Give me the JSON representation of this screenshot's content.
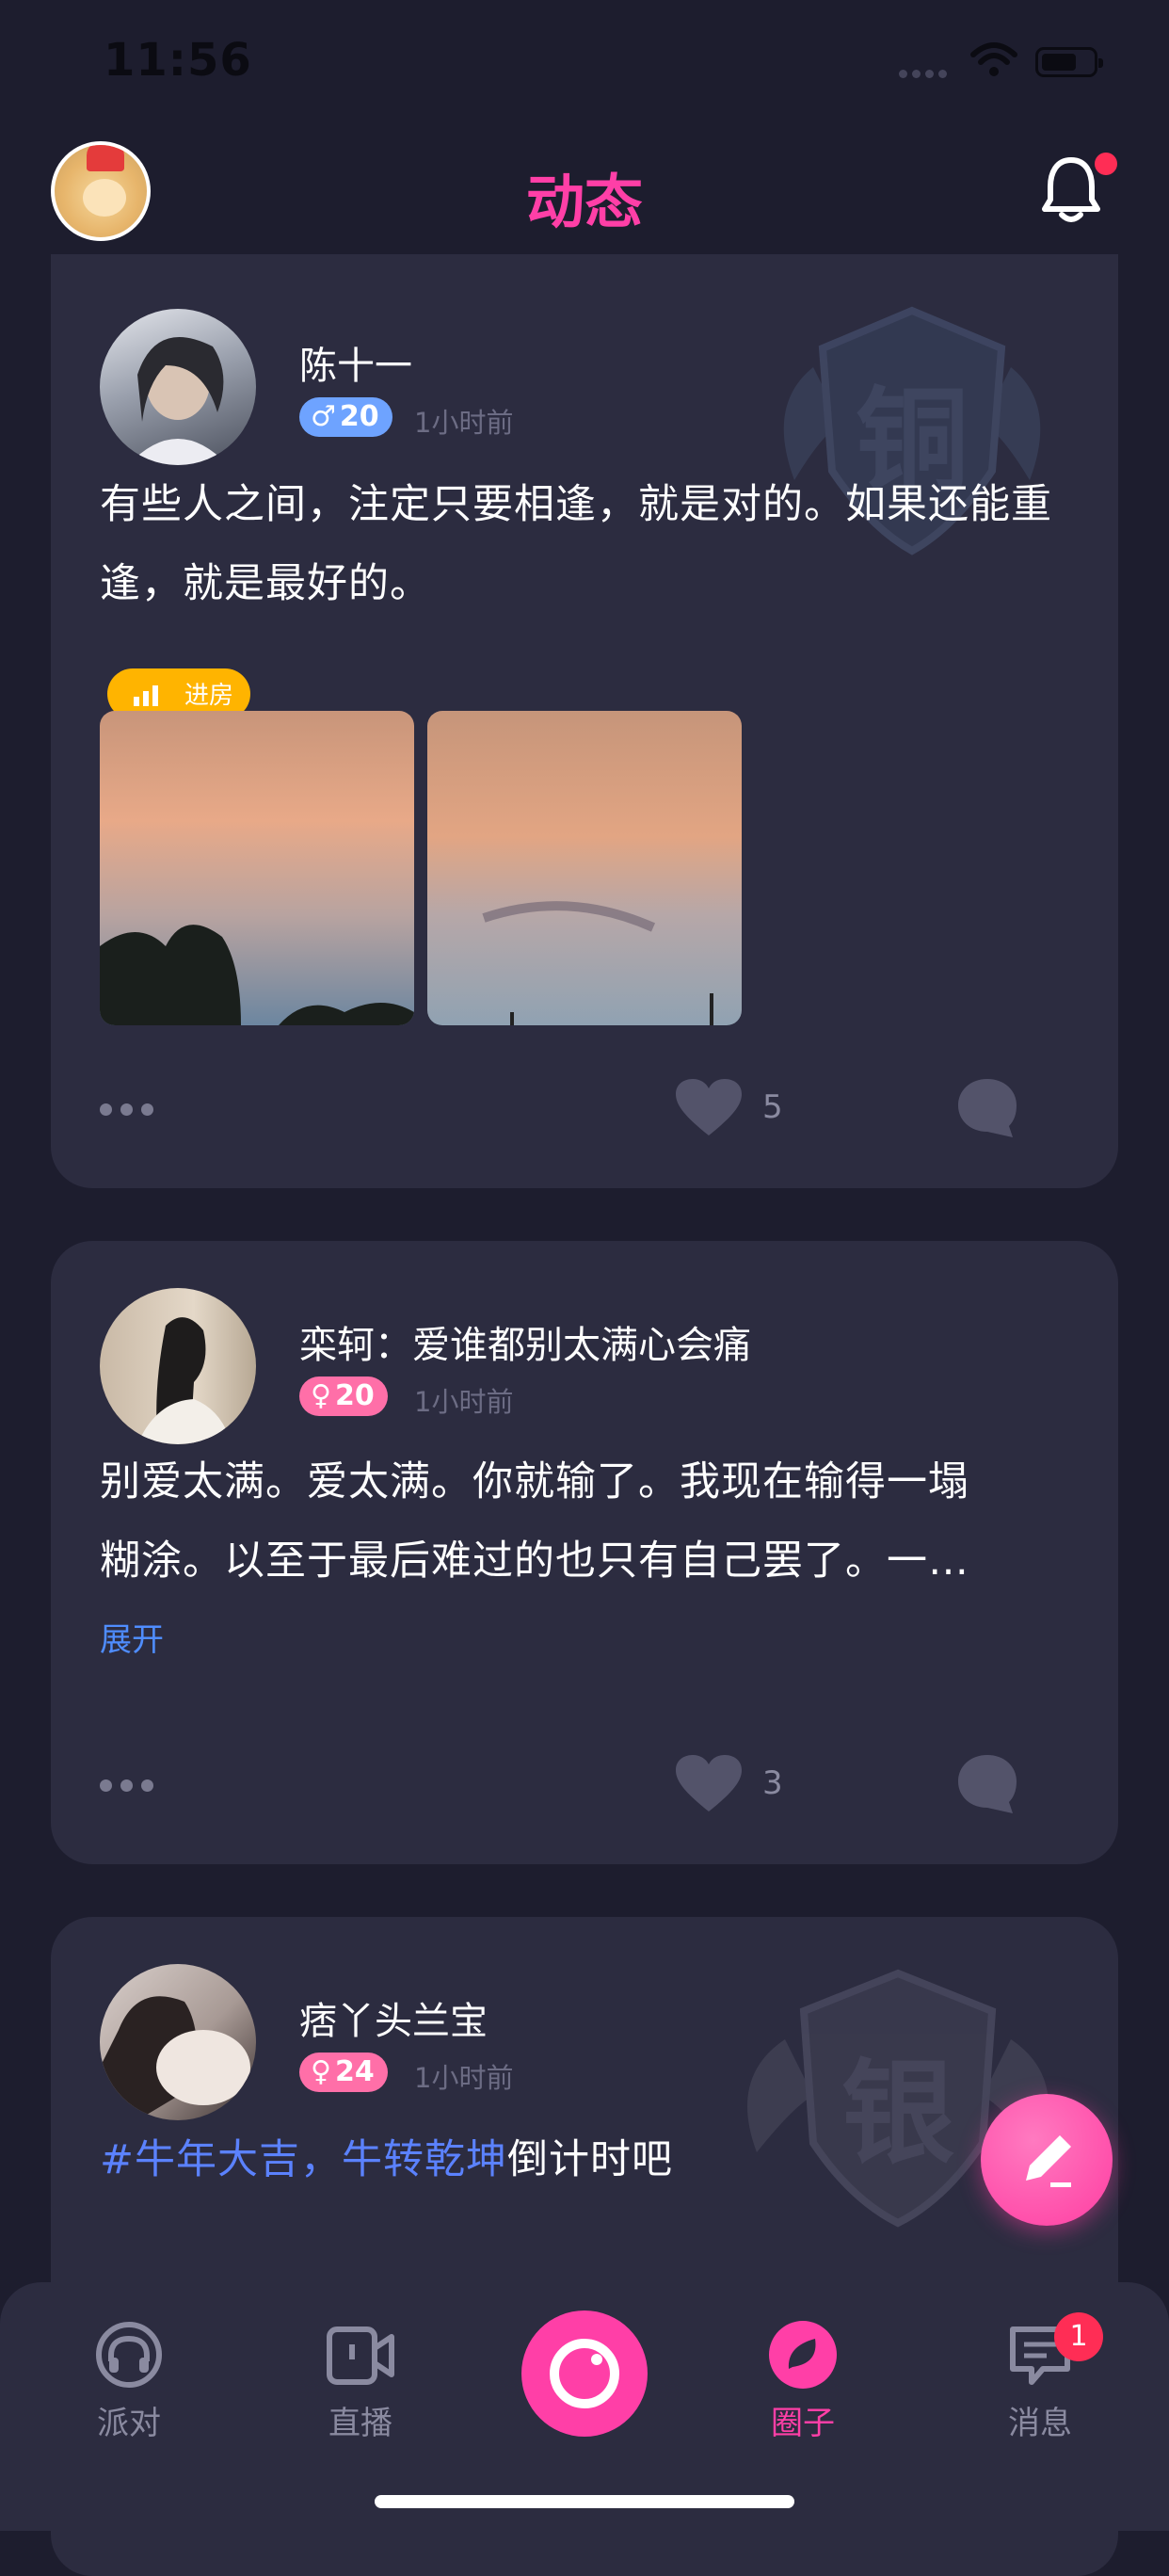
{
  "status_bar": {
    "time": "11:56"
  },
  "header": {
    "title": "动态"
  },
  "posts": [
    {
      "user": "陈十一",
      "gender": "male",
      "gender_symbol": "♂",
      "age": "20",
      "time_ago": "1小时前",
      "room_label": "进房",
      "text": "有些人之间，注定只要相逢，就是对的。如果还能重逢，就是最好的。",
      "likes": "5",
      "badge": "铜"
    },
    {
      "user": "栾轲：爱谁都别太满心会痛",
      "gender": "female",
      "gender_symbol": "♀",
      "age": "20",
      "time_ago": "1小时前",
      "text_line1": "别爱太满。爱太满。你就输了。我现在输得一塌",
      "text_line2": "糊涂。以至于最后难过的也只有自己罢了。一…",
      "expand_label": "展开",
      "likes": "3"
    },
    {
      "user": "痞丫头兰宝",
      "gender": "female",
      "gender_symbol": "♀",
      "age": "24",
      "time_ago": "1小时前",
      "hashtag": "#牛年大吉，牛转乾坤",
      "text": "倒计时吧",
      "badge": "银"
    }
  ],
  "tabbar": {
    "items": [
      {
        "label": "派对",
        "icon": "headphones-icon"
      },
      {
        "label": "直播",
        "icon": "video-camera-icon"
      },
      {
        "label": "",
        "icon": "center-camera-icon"
      },
      {
        "label": "圈子",
        "icon": "circle-leaf-icon"
      },
      {
        "label": "消息",
        "icon": "chat-icon"
      }
    ],
    "message_badge": "1"
  },
  "colors": {
    "accent": "#ff3fa7",
    "background": "#1d1d2e",
    "card": "#2c2c40",
    "male_tag": "#6ea3ff",
    "female_tag": "#ff6fa8",
    "link": "#4f8dff"
  }
}
